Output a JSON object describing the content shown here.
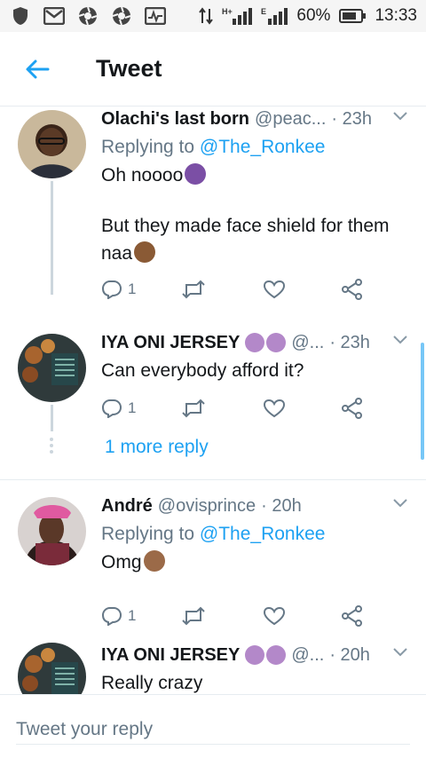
{
  "status_bar": {
    "battery": "60%",
    "time": "13:33",
    "network": "H+",
    "sim2": "E"
  },
  "header": {
    "title": "Tweet"
  },
  "colors": {
    "accent": "#1da1f2",
    "muted": "#657786",
    "text": "#14171a"
  },
  "tweets": [
    {
      "name": "Olachi's last born",
      "handle": "@peac...",
      "time": "· 23h",
      "replying_prefix": "Replying to ",
      "replying_to": "@The_Ronkee",
      "text_line1": "Oh noooo",
      "text_line2": "But they made face shield for them naa",
      "reply_count": "1"
    },
    {
      "name": "IYA ONI JERSEY",
      "handle": "@...",
      "time": "· 23h",
      "text_line1": "Can everybody afford it?",
      "reply_count": "1"
    },
    {
      "name": "André",
      "handle": "@ovisprince",
      "time": "· 20h",
      "replying_prefix": "Replying to ",
      "replying_to": "@The_Ronkee",
      "text_line1": "Omg",
      "reply_count": "1"
    },
    {
      "name": "IYA ONI JERSEY",
      "handle": "@...",
      "time": "· 20h",
      "text_line1": "Really crazy"
    }
  ],
  "more_reply_label": "1 more reply",
  "reply_bar": {
    "placeholder": "Tweet your reply"
  },
  "icons": {
    "back": "arrow-left-icon",
    "reply": "reply-icon",
    "retweet": "retweet-icon",
    "like": "heart-icon",
    "share": "share-icon",
    "menu": "chevron-down-icon"
  }
}
